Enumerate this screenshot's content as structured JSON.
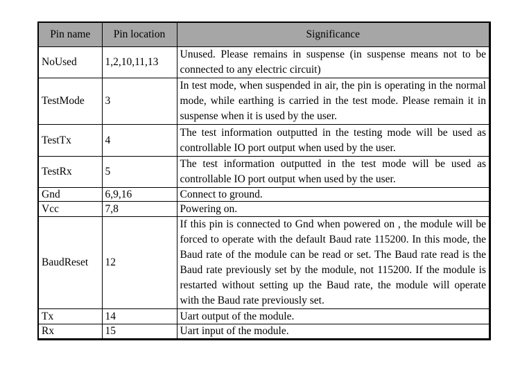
{
  "table": {
    "headers": {
      "pin_name": "Pin name",
      "pin_location": "Pin location",
      "significance": "Significance"
    },
    "header_bg_color": "#a6a6a6",
    "rows": [
      {
        "pin_name": "NoUsed",
        "pin_location": "1,2,10,11,13",
        "significance": "Unused. Please remains in suspense (in suspense means not to be connected to any electric circuit)"
      },
      {
        "pin_name": "TestMode",
        "pin_location": "3",
        "significance": "In test mode, when suspended in air, the pin is operating in the normal mode, while earthing is carried in the test mode. Please remain it in suspense when it is used by the user."
      },
      {
        "pin_name": "TestTx",
        "pin_location": "4",
        "significance": "The test information outputted in the testing mode will be used as controllable IO port output when used by the user."
      },
      {
        "pin_name": "TestRx",
        "pin_location": "5",
        "significance": "The test information outputted in the test mode will be used as controllable IO port output when used by the user."
      },
      {
        "pin_name": "Gnd",
        "pin_location": "6,9,16",
        "significance": "Connect to ground."
      },
      {
        "pin_name": "Vcc",
        "pin_location": "7,8",
        "significance": "Powering on."
      },
      {
        "pin_name": "BaudReset",
        "pin_location": "12",
        "significance": "If this pin is connected to Gnd when powered on , the module will be forced to operate with the default Baud rate 115200. In this mode, the Baud rate of the module can be read or set. The Baud rate read is the Baud rate previously set by the module, not 115200. If the module is restarted without setting up the Baud rate, the module will operate with the Baud rate previously set."
      },
      {
        "pin_name": "Tx",
        "pin_location": "14",
        "significance": "Uart output of the module."
      },
      {
        "pin_name": "Rx",
        "pin_location": "15",
        "significance": "Uart input of the module."
      }
    ]
  }
}
